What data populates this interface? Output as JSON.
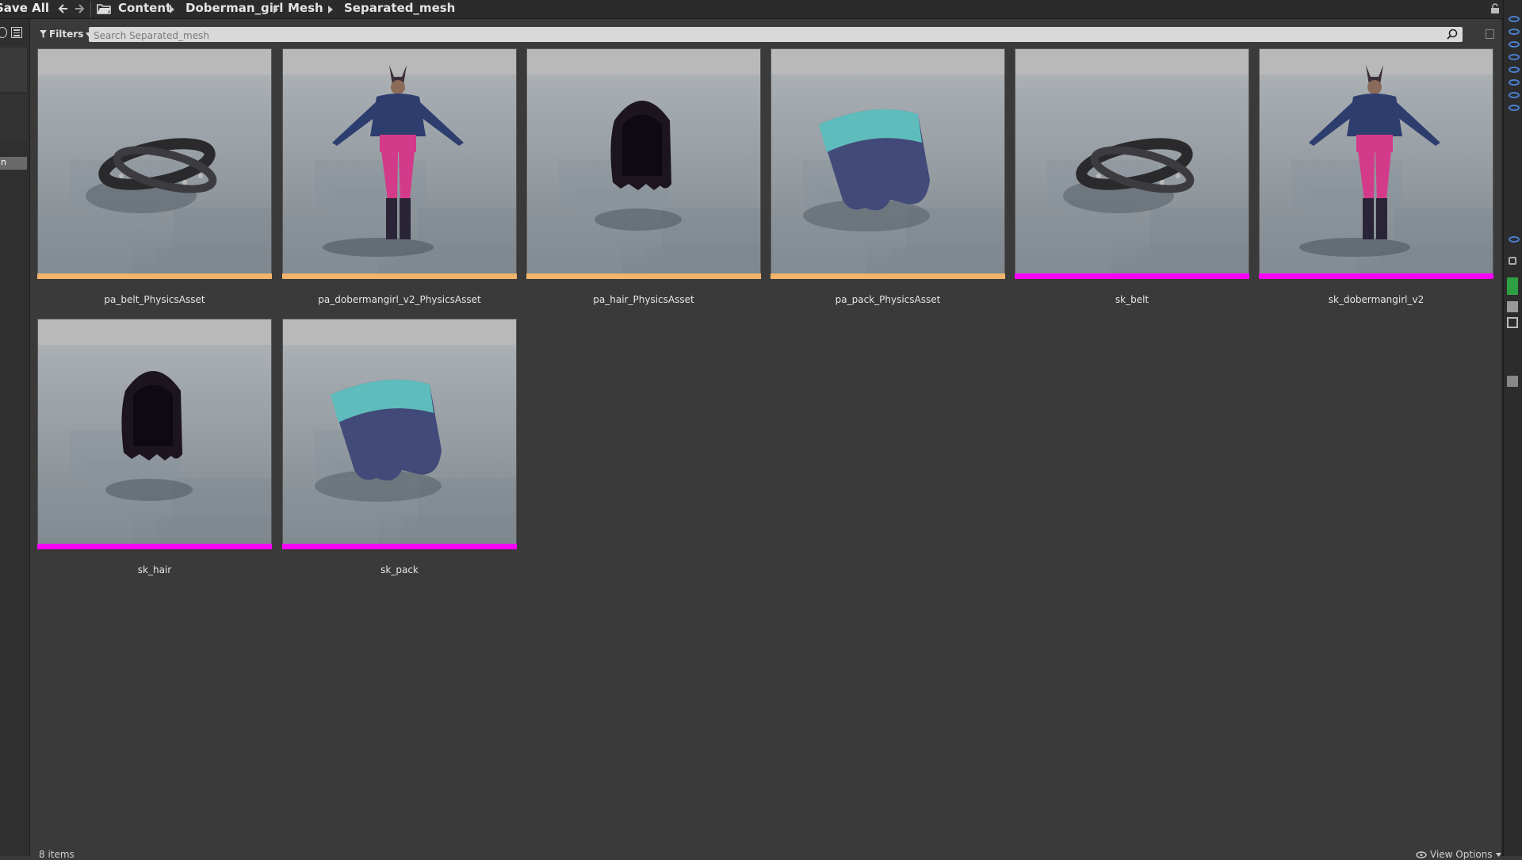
{
  "toolbar": {
    "save_all": "Save All",
    "breadcrumb": [
      "Content",
      "Doberman_girl",
      "Mesh",
      "Separated_mesh"
    ]
  },
  "left_panel": {
    "row_label": "n"
  },
  "filters": {
    "label": "Filters",
    "search_placeholder": "Search Separated_mesh"
  },
  "assets": [
    {
      "name": "pa_belt_PhysicsAsset",
      "type": "physics-asset",
      "thumb": "belt",
      "bar_color": "#f2b36b"
    },
    {
      "name": "pa_dobermangirl_v2_PhysicsAsset",
      "type": "physics-asset",
      "thumb": "girl",
      "bar_color": "#f2b36b"
    },
    {
      "name": "pa_hair_PhysicsAsset",
      "type": "physics-asset",
      "thumb": "hair",
      "bar_color": "#f2b36b"
    },
    {
      "name": "pa_pack_PhysicsAsset",
      "type": "physics-asset",
      "thumb": "pack",
      "bar_color": "#f2b36b"
    },
    {
      "name": "sk_belt",
      "type": "skeletal-mesh",
      "thumb": "belt",
      "bar_color": "#ff00ff"
    },
    {
      "name": "sk_dobermangirl_v2",
      "type": "skeletal-mesh",
      "thumb": "girl",
      "bar_color": "#ff00ff"
    },
    {
      "name": "sk_hair",
      "type": "skeletal-mesh",
      "thumb": "hair",
      "bar_color": "#ff00ff"
    },
    {
      "name": "sk_pack",
      "type": "skeletal-mesh",
      "thumb": "pack",
      "bar_color": "#ff00ff"
    }
  ],
  "status": {
    "item_count": "8 items",
    "view_options": "View Options"
  },
  "colors": {
    "physics_asset_bar": "#f2b36b",
    "skeletal_mesh_bar": "#ff00ff",
    "accent_blue": "#4a7fd0",
    "accent_green": "#2ea043"
  }
}
